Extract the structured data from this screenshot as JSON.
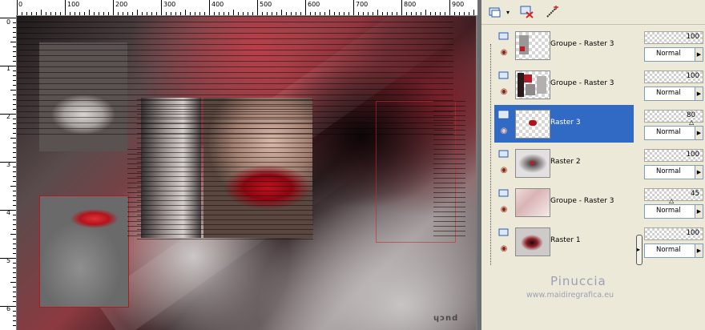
{
  "ruler": {
    "top_labels": [
      "0",
      "100",
      "200",
      "300",
      "400",
      "500",
      "600",
      "700",
      "800",
      "900"
    ],
    "left_labels": [
      "0",
      "1",
      "2",
      "3",
      "4",
      "5",
      "6"
    ]
  },
  "canvas": {
    "watermark": "ɥɔnd"
  },
  "toolbar": {
    "buttons": [
      "new-layer-icon",
      "dropdown-arrow-icon",
      "delete-layer-icon",
      "edit-mask-icon"
    ]
  },
  "layers": [
    {
      "name": "Groupe - Raster 3",
      "opacity": "100",
      "blend": "Normal",
      "selected": false
    },
    {
      "name": "Groupe - Raster 3",
      "opacity": "100",
      "blend": "Normal",
      "selected": false
    },
    {
      "name": "Raster 3",
      "opacity": "80",
      "blend": "Normal",
      "selected": true
    },
    {
      "name": "Raster 2",
      "opacity": "100",
      "blend": "Normal",
      "selected": false
    },
    {
      "name": "Groupe - Raster 3",
      "opacity": "45",
      "blend": "Normal",
      "selected": false
    },
    {
      "name": "Raster 1",
      "opacity": "100",
      "blend": "Normal",
      "selected": false
    }
  ],
  "brand": {
    "name": "Pinuccia",
    "url": "www.maidiregrafica.eu"
  },
  "colors": {
    "selection": "#316ac5",
    "panel_bg": "#ece9d8",
    "brand_text": "#9d9fb5"
  }
}
